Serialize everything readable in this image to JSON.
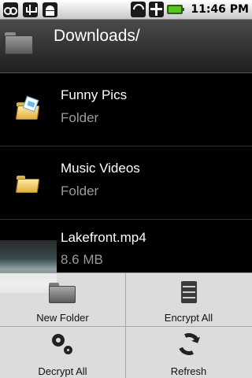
{
  "status_bar": {
    "time": "11:46 PM",
    "icons": [
      "voicemail-icon",
      "usb-icon",
      "android-icon",
      "wifi-icon",
      "airplane-icon",
      "battery-icon"
    ],
    "battery_color": "#58c420"
  },
  "header": {
    "title": "Downloads/",
    "icon": "folder-icon"
  },
  "files": [
    {
      "name": "Funny Pics",
      "detail": "Folder",
      "icon": "folder-pictures-icon"
    },
    {
      "name": "Music Videos",
      "detail": "Folder",
      "icon": "folder-icon"
    },
    {
      "name": "Lakefront.mp4",
      "detail": "8.6 MB",
      "icon": "video-thumbnail"
    }
  ],
  "menu": {
    "items": [
      {
        "label": "New Folder",
        "icon": "new-folder-icon"
      },
      {
        "label": "Encrypt All",
        "icon": "encrypt-icon"
      },
      {
        "label": "Decrypt All",
        "icon": "decrypt-gears-icon"
      },
      {
        "label": "Refresh",
        "icon": "refresh-icon"
      }
    ]
  }
}
